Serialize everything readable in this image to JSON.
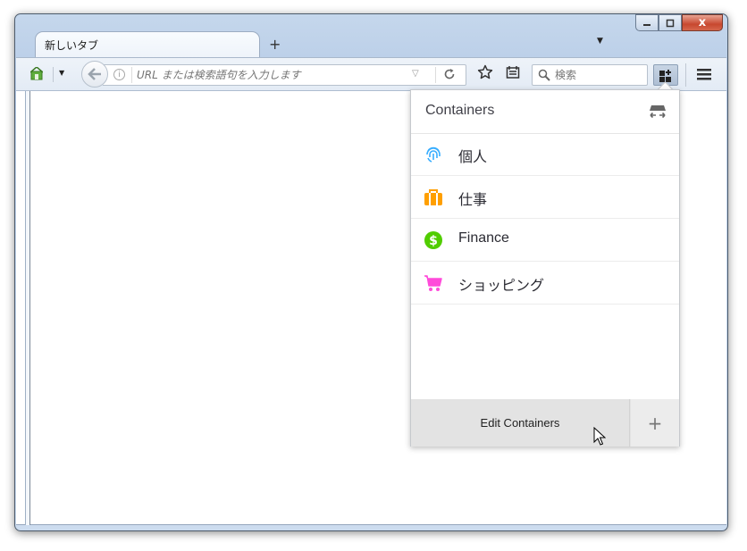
{
  "window": {
    "controls": {
      "minimize": "",
      "maximize": "",
      "close": "x"
    }
  },
  "tab": {
    "title": "新しいタブ",
    "new_tab_icon": "+",
    "tab_list_icon": "▼"
  },
  "toolbar": {
    "url_placeholder": "URL または検索語句を入力します",
    "url_value": "",
    "search_placeholder": "検索",
    "search_value": ""
  },
  "containers_panel": {
    "title": "Containers",
    "items": [
      {
        "label": "個人",
        "icon": "fingerprint-icon",
        "color": "#37adff"
      },
      {
        "label": "仕事",
        "icon": "briefcase-icon",
        "color": "#ff9f00"
      },
      {
        "label": "Finance",
        "icon": "dollar-icon",
        "color": "#51cd00"
      },
      {
        "label": "ショッピング",
        "icon": "cart-icon",
        "color": "#ff4bda"
      }
    ],
    "edit_label": "Edit Containers",
    "add_label": "+"
  }
}
